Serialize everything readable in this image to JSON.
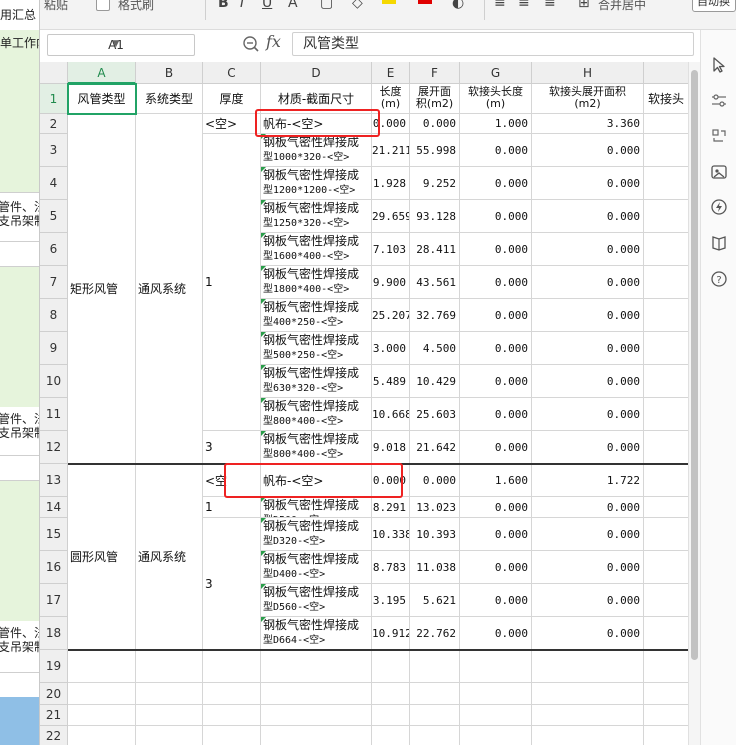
{
  "toolbar": {
    "left_text": "粘贴",
    "style_text": "格式刷",
    "right_text": "合并居中",
    "pill_text": "自动换"
  },
  "left_panel": {
    "tab1": "用汇总",
    "tab2": "单工作内",
    "group_text1": "管件、法",
    "group_text2": "支吊架制",
    "group_text3": "管件、法",
    "group_text4": "支吊架制",
    "group_text5": "管件、法",
    "group_text6": "支吊架制"
  },
  "formula_bar": {
    "name_box": "A1",
    "fx_label": "fx",
    "formula": "风管类型"
  },
  "columns": [
    {
      "letter": "A"
    },
    {
      "letter": "B"
    },
    {
      "letter": "C"
    },
    {
      "letter": "D"
    },
    {
      "letter": "E"
    },
    {
      "letter": "F"
    },
    {
      "letter": "G"
    },
    {
      "letter": "H"
    },
    {
      "letter": ""
    }
  ],
  "header_row": {
    "a": "风管类型",
    "b": "系统类型",
    "c": "厚度",
    "d": "材质-截面尺寸",
    "e1": "长度",
    "e2": "(m)",
    "f1": "展开面",
    "f2": "积(m2)",
    "g1": "软接头长度",
    "g2": "(m)",
    "h1": "软接头展开面积",
    "h2": "(m2)",
    "i": "软接头"
  },
  "groups": {
    "rect_type": "矩形风管",
    "rect_system": "通风系统",
    "round_type": "圆形风管",
    "round_system": "通风系统",
    "thickness_1": "1",
    "thickness_3": "3",
    "empty_mark": "<空>"
  },
  "rows": [
    {
      "num": "2",
      "c": "<空>",
      "d1": "帆布-<空>",
      "d2": "",
      "e": "0.000",
      "f": "0.000",
      "g": "1.000",
      "h": "3.360"
    },
    {
      "num": "3",
      "c": "",
      "d1": "钢板气密性焊接成",
      "d2": "型1000*320-<空>",
      "e": "21.211",
      "f": "55.998",
      "g": "0.000",
      "h": "0.000"
    },
    {
      "num": "4",
      "c": "",
      "d1": "钢板气密性焊接成",
      "d2": "型1200*1200-<空>",
      "e": "1.928",
      "f": "9.252",
      "g": "0.000",
      "h": "0.000"
    },
    {
      "num": "5",
      "c": "",
      "d1": "钢板气密性焊接成",
      "d2": "型1250*320-<空>",
      "e": "29.659",
      "f": "93.128",
      "g": "0.000",
      "h": "0.000"
    },
    {
      "num": "6",
      "c": "",
      "d1": "钢板气密性焊接成",
      "d2": "型1600*400-<空>",
      "e": "7.103",
      "f": "28.411",
      "g": "0.000",
      "h": "0.000"
    },
    {
      "num": "7",
      "c": "",
      "d1": "钢板气密性焊接成",
      "d2": "型1800*400-<空>",
      "e": "9.900",
      "f": "43.561",
      "g": "0.000",
      "h": "0.000"
    },
    {
      "num": "8",
      "c": "",
      "d1": "钢板气密性焊接成",
      "d2": "型400*250-<空>",
      "e": "25.207",
      "f": "32.769",
      "g": "0.000",
      "h": "0.000"
    },
    {
      "num": "9",
      "c": "",
      "d1": "钢板气密性焊接成",
      "d2": "型500*250-<空>",
      "e": "3.000",
      "f": "4.500",
      "g": "0.000",
      "h": "0.000"
    },
    {
      "num": "10",
      "c": "",
      "d1": "钢板气密性焊接成",
      "d2": "型630*320-<空>",
      "e": "5.489",
      "f": "10.429",
      "g": "0.000",
      "h": "0.000"
    },
    {
      "num": "11",
      "c": "",
      "d1": "钢板气密性焊接成",
      "d2": "型800*400-<空>",
      "e": "10.668",
      "f": "25.603",
      "g": "0.000",
      "h": "0.000"
    },
    {
      "num": "12",
      "c": "3",
      "d1": "钢板气密性焊接成",
      "d2": "型800*400-<空>",
      "e": "9.018",
      "f": "21.642",
      "g": "0.000",
      "h": "0.000"
    },
    {
      "num": "13",
      "c": "<空",
      "d1": "帆布-<空>",
      "d2": "",
      "e": "0.000",
      "f": "0.000",
      "g": "1.600",
      "h": "1.722"
    },
    {
      "num": "14",
      "c": "1",
      "d1": "钢板气密性焊接成",
      "d2": "型D500-<空>",
      "e": "8.291",
      "f": "13.023",
      "g": "0.000",
      "h": "0.000"
    },
    {
      "num": "15",
      "c": "",
      "d1": "钢板气密性焊接成",
      "d2": "型D320-<空>",
      "e": "10.338",
      "f": "10.393",
      "g": "0.000",
      "h": "0.000"
    },
    {
      "num": "16",
      "c": "",
      "d1": "钢板气密性焊接成",
      "d2": "型D400-<空>",
      "e": "8.783",
      "f": "11.038",
      "g": "0.000",
      "h": "0.000"
    },
    {
      "num": "17",
      "c": "",
      "d1": "钢板气密性焊接成",
      "d2": "型D560-<空>",
      "e": "3.195",
      "f": "5.621",
      "g": "0.000",
      "h": "0.000"
    },
    {
      "num": "18",
      "c": "",
      "d1": "钢板气密性焊接成",
      "d2": "型D664-<空>",
      "e": "10.912",
      "f": "22.762",
      "g": "0.000",
      "h": "0.000"
    }
  ],
  "empty_rows": [
    "19",
    "20",
    "21",
    "22",
    "23"
  ],
  "row1_num": "1",
  "colors": {
    "accent_green": "#21a366",
    "highlight_red": "#e22222"
  },
  "right_icons": [
    "cursor-icon",
    "sliders-icon",
    "swap-icon",
    "image-icon",
    "lightning-icon",
    "book-icon",
    "help-icon"
  ]
}
